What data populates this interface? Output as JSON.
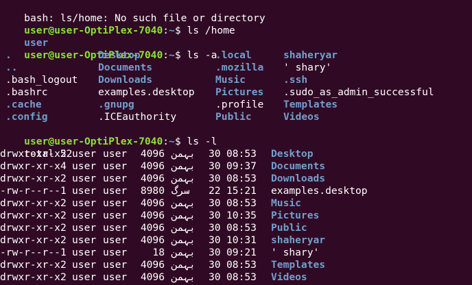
{
  "colors": {
    "background": "#300a24",
    "prompt_user": "#8ae234",
    "prompt_path": "#729fcf",
    "directory": "#729fcf",
    "text": "#ffffff"
  },
  "prompt": {
    "user_host": "user@user-OptiPlex-7040",
    "sep": ":",
    "path": "~",
    "symbol": "$ "
  },
  "lines": {
    "error": "bash: ls/home: No such file or directory",
    "cmd1": "ls /home",
    "out1": "user",
    "cmd2": "ls -a",
    "cmd3": "ls -l",
    "total": "total 52"
  },
  "ls_a": {
    "rows": [
      [
        {
          "name": ".",
          "kind": "dir"
        },
        {
          "name": "Desktop",
          "kind": "dir"
        },
        {
          "name": ".local",
          "kind": "dir"
        },
        {
          "name": "shaheryar",
          "kind": "dir"
        }
      ],
      [
        {
          "name": "..",
          "kind": "dir"
        },
        {
          "name": "Documents",
          "kind": "dir"
        },
        {
          "name": ".mozilla",
          "kind": "dir"
        },
        {
          "name": "' shary'",
          "kind": "file"
        }
      ],
      [
        {
          "name": ".bash_logout",
          "kind": "file"
        },
        {
          "name": "Downloads",
          "kind": "dir"
        },
        {
          "name": "Music",
          "kind": "dir"
        },
        {
          "name": ".ssh",
          "kind": "dir"
        }
      ],
      [
        {
          "name": ".bashrc",
          "kind": "file"
        },
        {
          "name": "examples.desktop",
          "kind": "file"
        },
        {
          "name": "Pictures",
          "kind": "dir"
        },
        {
          "name": ".sudo_as_admin_successful",
          "kind": "file"
        }
      ],
      [
        {
          "name": ".cache",
          "kind": "dir"
        },
        {
          "name": ".gnupg",
          "kind": "dir"
        },
        {
          "name": ".profile",
          "kind": "file"
        },
        {
          "name": "Templates",
          "kind": "dir"
        }
      ],
      [
        {
          "name": ".config",
          "kind": "dir"
        },
        {
          "name": ".ICEauthority",
          "kind": "file"
        },
        {
          "name": "Public",
          "kind": "dir"
        },
        {
          "name": "Videos",
          "kind": "dir"
        }
      ]
    ]
  },
  "ls_l": {
    "rows": [
      {
        "perms": "drwxr-xr-x",
        "links": "2",
        "owner": "user",
        "group": "user",
        "size": "4096",
        "month": "بہمن",
        "day": "30",
        "time": "08:53",
        "name": "Desktop",
        "kind": "dir"
      },
      {
        "perms": "drwxr-xr-x",
        "links": "4",
        "owner": "user",
        "group": "user",
        "size": "4096",
        "month": "بہمن",
        "day": "30",
        "time": "09:37",
        "name": "Documents",
        "kind": "dir"
      },
      {
        "perms": "drwxr-xr-x",
        "links": "2",
        "owner": "user",
        "group": "user",
        "size": "4096",
        "month": "بہمن",
        "day": "30",
        "time": "08:53",
        "name": "Downloads",
        "kind": "dir"
      },
      {
        "perms": "-rw-r--r--",
        "links": "1",
        "owner": "user",
        "group": "user",
        "size": "8980",
        "month": "سرگ",
        "day": "22",
        "time": "15:21",
        "name": "examples.desktop",
        "kind": "file"
      },
      {
        "perms": "drwxr-xr-x",
        "links": "2",
        "owner": "user",
        "group": "user",
        "size": "4096",
        "month": "بہمن",
        "day": "30",
        "time": "08:53",
        "name": "Music",
        "kind": "dir"
      },
      {
        "perms": "drwxr-xr-x",
        "links": "2",
        "owner": "user",
        "group": "user",
        "size": "4096",
        "month": "بہمن",
        "day": "30",
        "time": "10:35",
        "name": "Pictures",
        "kind": "dir"
      },
      {
        "perms": "drwxr-xr-x",
        "links": "2",
        "owner": "user",
        "group": "user",
        "size": "4096",
        "month": "بہمن",
        "day": "30",
        "time": "08:53",
        "name": "Public",
        "kind": "dir"
      },
      {
        "perms": "drwxr-xr-x",
        "links": "2",
        "owner": "user",
        "group": "user",
        "size": "4096",
        "month": "بہمن",
        "day": "30",
        "time": "10:31",
        "name": "shaheryar",
        "kind": "dir"
      },
      {
        "perms": "-rw-r--r--",
        "links": "1",
        "owner": "user",
        "group": "user",
        "size": "18",
        "month": "بہمن",
        "day": "30",
        "time": "09:21",
        "name": "' shary'",
        "kind": "file"
      },
      {
        "perms": "drwxr-xr-x",
        "links": "2",
        "owner": "user",
        "group": "user",
        "size": "4096",
        "month": "بہمن",
        "day": "30",
        "time": "08:53",
        "name": "Templates",
        "kind": "dir"
      },
      {
        "perms": "drwxr-xr-x",
        "links": "2",
        "owner": "user",
        "group": "user",
        "size": "4096",
        "month": "بہمن",
        "day": "30",
        "time": "08:53",
        "name": "Videos",
        "kind": "dir"
      }
    ]
  }
}
